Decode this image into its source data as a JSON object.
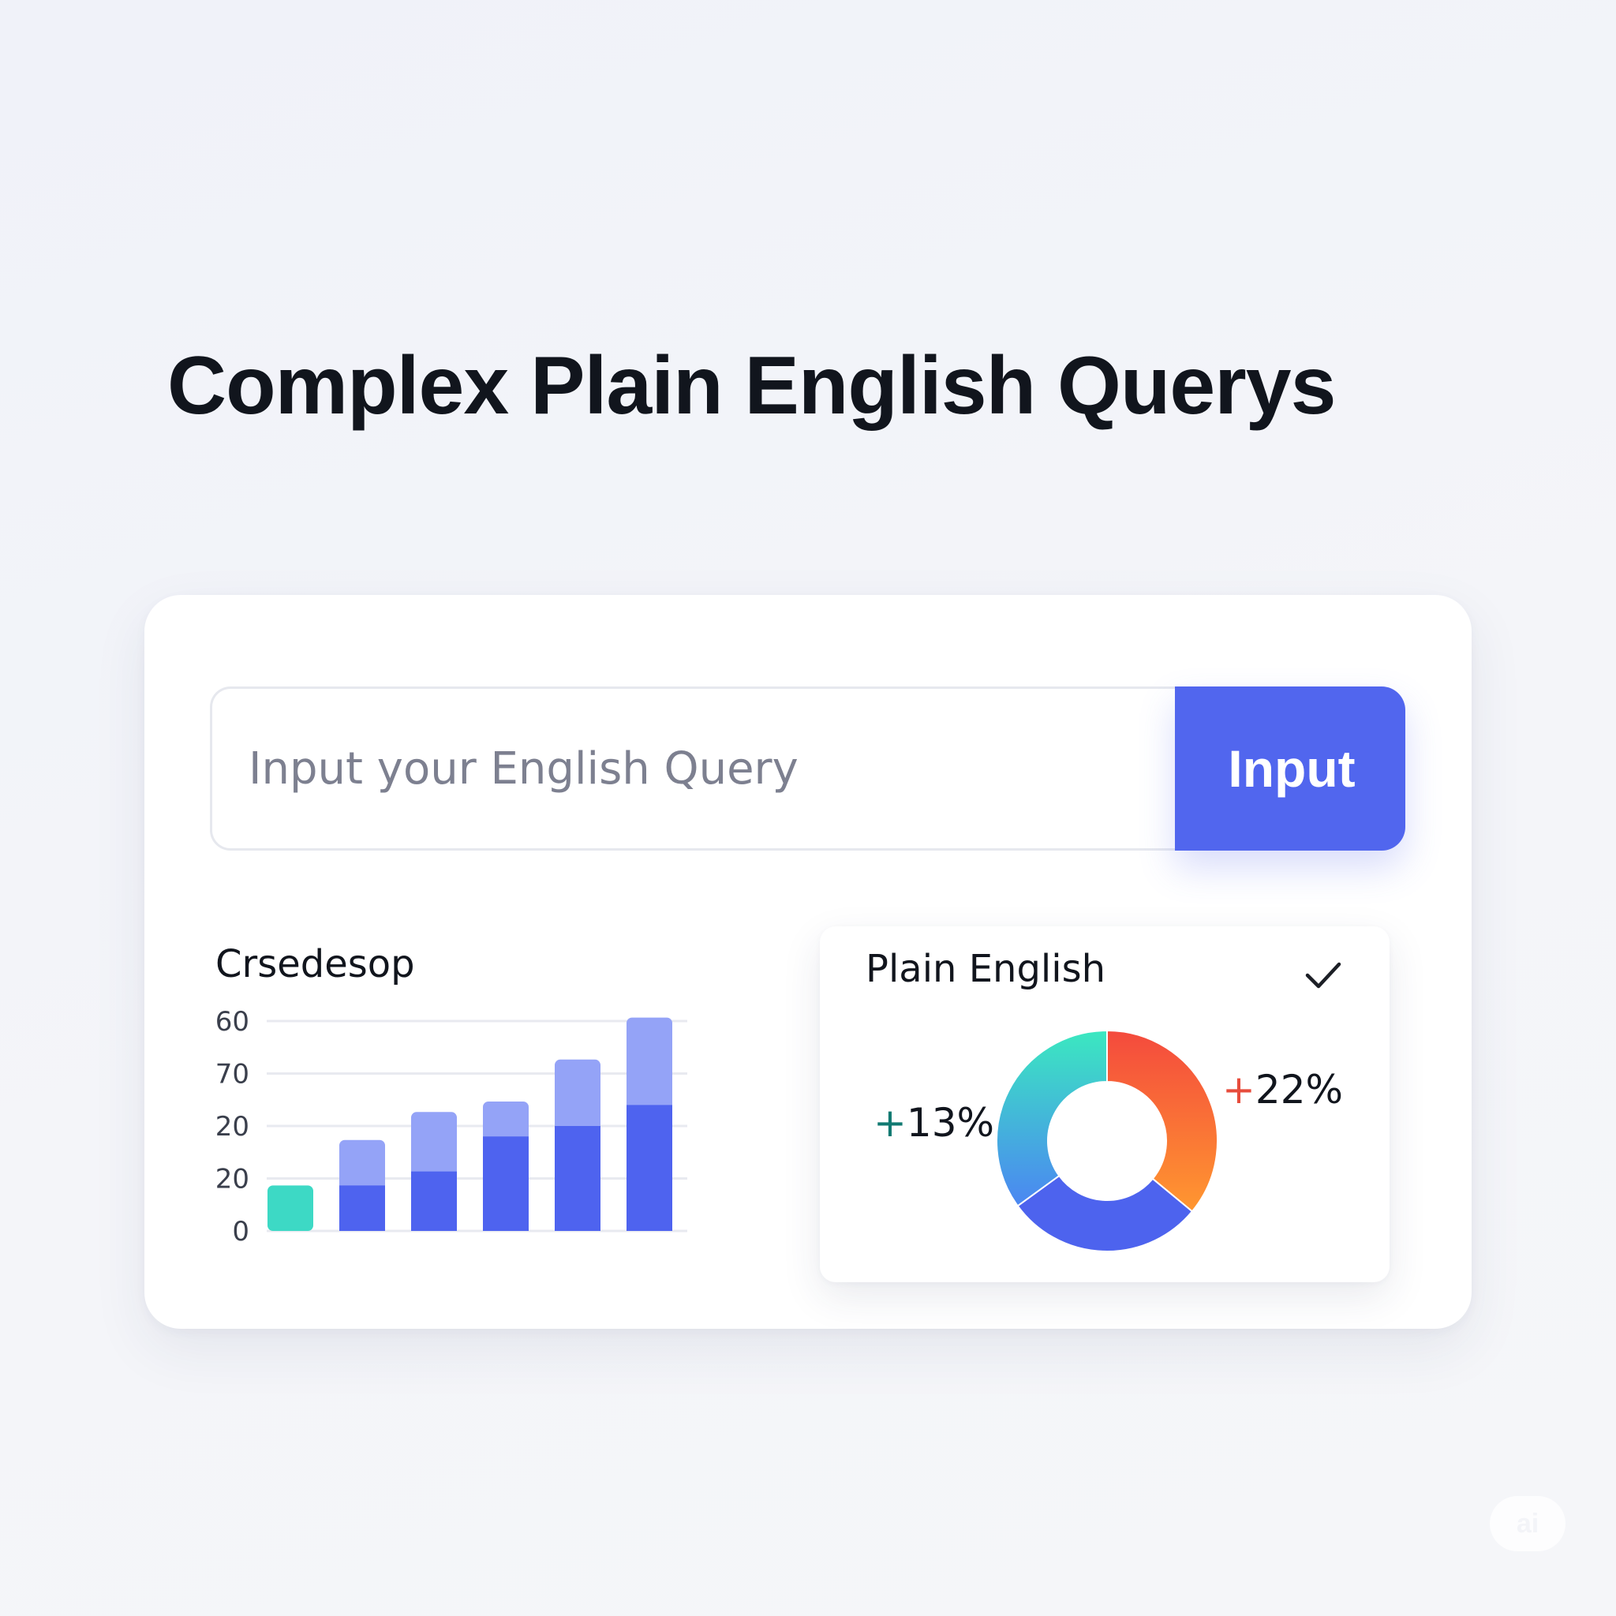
{
  "page": {
    "title": "Complex Plain English Querys"
  },
  "query": {
    "placeholder": "Input your English Query",
    "value": "",
    "button_label": "Input"
  },
  "bar_panel": {
    "title": "Crsedesop"
  },
  "pie_panel": {
    "title": "Plain English",
    "check_icon": "check-icon",
    "delta_left_sign": "+",
    "delta_left_value": "13%",
    "delta_right_sign": "+",
    "delta_right_value": "22%"
  },
  "badge": {
    "text": "ai"
  },
  "colors": {
    "accent": "#5166ee",
    "bar_base": "#4e63ef",
    "bar_top": "#94a3f7",
    "teal": "#3dd9c5",
    "grid": "#e8eaf0",
    "tick_text": "#3a3f4c",
    "pie_red": "#f44a3d",
    "pie_orange": "#ff9730",
    "pie_blue": "#4d63ee",
    "pie_teal": "#3be8c0",
    "delta_left": "#127a72",
    "delta_right": "#e74c3c"
  },
  "chart_data": [
    {
      "type": "bar",
      "title": "Crsedesop",
      "y_tick_labels": [
        "60",
        "70",
        "20",
        "20",
        "0"
      ],
      "ylim": [
        0,
        60
      ],
      "grid": true,
      "stacked": true,
      "series": [
        {
          "values": [
            13,
            13,
            17,
            27,
            30,
            36
          ]
        },
        {
          "values": [
            0,
            13,
            17,
            10,
            19,
            25
          ]
        }
      ]
    },
    {
      "type": "pie",
      "title": "Plain English",
      "donut": true,
      "slices": [
        {
          "value": 36
        },
        {
          "value": 29
        },
        {
          "value": 35
        }
      ],
      "annotations": [
        "+13%",
        "+22%"
      ]
    }
  ]
}
